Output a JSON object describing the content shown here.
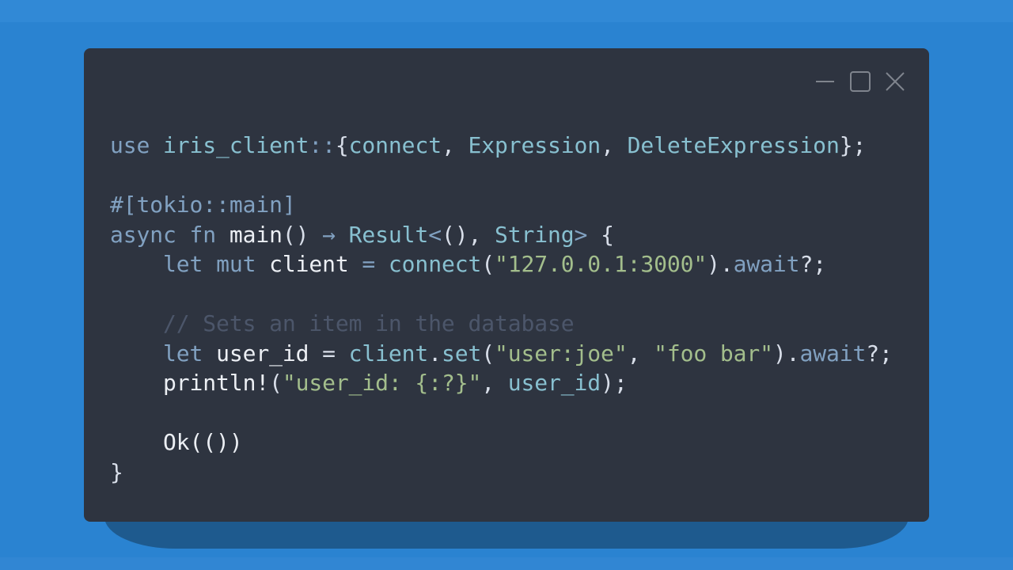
{
  "window": {
    "controls": [
      {
        "name": "minimize",
        "icon": "minimize-icon"
      },
      {
        "name": "maximize",
        "icon": "maximize-icon"
      },
      {
        "name": "close",
        "icon": "close-icon"
      }
    ]
  },
  "colors": {
    "background": "#2a83d1",
    "editor": "#2e3440",
    "keyword": "#81a1c1",
    "function": "#88c0d0",
    "string": "#a3be8c",
    "comment": "#4c566a",
    "text": "#eceff4"
  },
  "code": {
    "lines": [
      [
        [
          "use ",
          "kw"
        ],
        [
          "iris_client",
          "fn"
        ],
        [
          "::",
          "kw"
        ],
        [
          "{",
          "pn"
        ],
        [
          "connect",
          "fn"
        ],
        [
          ", ",
          "pn"
        ],
        [
          "Expression",
          "fn"
        ],
        [
          ", ",
          "pn"
        ],
        [
          "DeleteExpression",
          "fn"
        ],
        [
          "};",
          "pn"
        ]
      ],
      [],
      [
        [
          "#[tokio::main]",
          "kw"
        ]
      ],
      [
        [
          "async ",
          "kw"
        ],
        [
          "fn ",
          "kw"
        ],
        [
          "main",
          "tx"
        ],
        [
          "() ",
          "pn"
        ],
        [
          "→ ",
          "op"
        ],
        [
          "Result",
          "fn"
        ],
        [
          "<",
          "kw"
        ],
        [
          "(), ",
          "pn"
        ],
        [
          "String",
          "fn"
        ],
        [
          "> ",
          "kw"
        ],
        [
          "{",
          "pn"
        ]
      ],
      [
        [
          "    let ",
          "kw"
        ],
        [
          "mut ",
          "kw"
        ],
        [
          "client ",
          "tx"
        ],
        [
          "= ",
          "op"
        ],
        [
          "connect",
          "fn"
        ],
        [
          "(",
          "pn"
        ],
        [
          "\"127.0.0.1:3000\"",
          "str"
        ],
        [
          ").",
          "pn"
        ],
        [
          "await",
          "kw"
        ],
        [
          "?;",
          "pn"
        ]
      ],
      [],
      [
        [
          "    // Sets an item in the database",
          "cm"
        ]
      ],
      [
        [
          "    let ",
          "kw"
        ],
        [
          "user_id ",
          "tx"
        ],
        [
          "= ",
          "pn"
        ],
        [
          "client",
          "fn"
        ],
        [
          ".",
          "pn"
        ],
        [
          "set",
          "fn"
        ],
        [
          "(",
          "pn"
        ],
        [
          "\"user:joe\"",
          "str"
        ],
        [
          ", ",
          "pn"
        ],
        [
          "\"foo bar\"",
          "str"
        ],
        [
          ").",
          "pn"
        ],
        [
          "await",
          "kw"
        ],
        [
          "?;",
          "pn"
        ]
      ],
      [
        [
          "    println!",
          "tx"
        ],
        [
          "(",
          "pn"
        ],
        [
          "\"user_id: {:?}\"",
          "str"
        ],
        [
          ", ",
          "pn"
        ],
        [
          "user_id",
          "fn"
        ],
        [
          ");",
          "pn"
        ]
      ],
      [],
      [
        [
          "    Ok(())",
          "tx"
        ]
      ],
      [
        [
          "}",
          "pn"
        ]
      ]
    ]
  }
}
